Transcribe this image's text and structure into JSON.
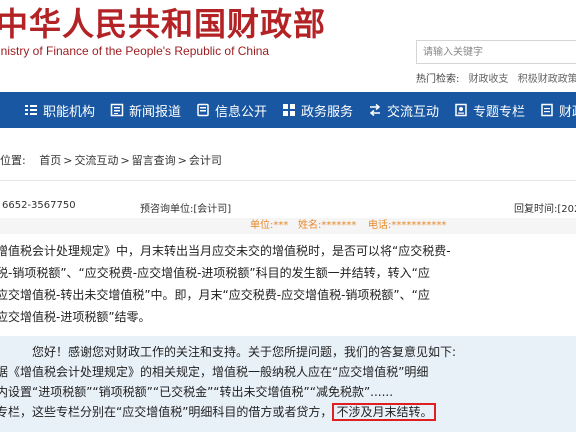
{
  "header": {
    "title": "中华人民共和国财政部",
    "subtitle": "inistry of Finance of the People's Republic of China"
  },
  "search": {
    "placeholder": "请输入关键字"
  },
  "hot": {
    "label": "热门检索:",
    "items": [
      "财政收支",
      "积极财政政策"
    ]
  },
  "nav": {
    "items": [
      {
        "label": "职能机构"
      },
      {
        "label": "新闻报道"
      },
      {
        "label": "信息公开"
      },
      {
        "label": "政务服务"
      },
      {
        "label": "交流互动"
      },
      {
        "label": "专题专栏"
      },
      {
        "label": "财政"
      }
    ]
  },
  "breadcrumb": {
    "prefix": "位置:",
    "items": [
      "首页",
      "交流互动",
      "留言查询",
      "会计司"
    ],
    "sep": ">"
  },
  "message": {
    "phone": "6652-3567750",
    "unit": "预咨询单位:[会计司]",
    "reply_time": "回复时间:[202",
    "meta_unit": "单位:***",
    "meta_name": "姓名:*******",
    "meta_tel": "电话:***********"
  },
  "question": {
    "lines": [
      "增值税会计处理规定》中，月末转出当月应交未交的增值税时，是否可以将“应交税费-",
      "税-销项税额”、“应交税费-应交增值税-进项税额”科目的发生额一并结转，转入“应",
      "应交增值税-转出未交增值税”中。即，月末“应交税费-应交增值税-销项税额”、“应",
      "应交增值税-进项税额”结零。"
    ]
  },
  "answer": {
    "lines": [
      "您好！感谢您对财政工作的关注和支持。关于您所提问题，我们的答复意见如下:",
      "据《增值税会计处理规定》的相关规定，增值税一般纳税人应在“应交增值税”明细",
      "内设置“进项税额”“销项税额”“已交税金”“转出未交增值税”“减免税款”......",
      "专栏，这些专栏分别在“应交增值税”明细科目的借方或者贷方，"
    ],
    "highlight": "不涉及月末结转。"
  },
  "colors": {
    "brand_red": "#b32325",
    "nav_blue": "#1957a3",
    "answer_bg": "#e8f0f8",
    "highlight_border": "#e02020",
    "meta_orange": "#e88a2d"
  },
  "icons": [
    "grid-list-icon",
    "news-doc-icon",
    "info-doc-icon",
    "service-grid-icon",
    "exchange-arrows-icon",
    "topic-doc-icon",
    "finance-doc-icon"
  ]
}
